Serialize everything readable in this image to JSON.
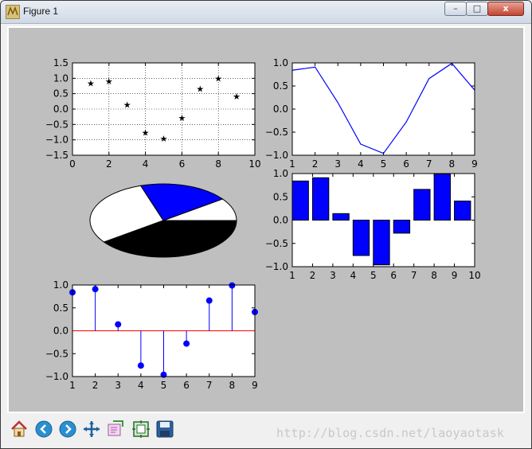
{
  "window": {
    "title": "Figure 1",
    "buttons": {
      "minimize": "–",
      "maximize": "□",
      "close": "x"
    }
  },
  "toolbar": {
    "items": [
      {
        "name": "home",
        "icon": "home-icon"
      },
      {
        "name": "back",
        "icon": "arrow-left-icon"
      },
      {
        "name": "forward",
        "icon": "arrow-right-icon"
      },
      {
        "name": "pan",
        "icon": "move-icon"
      },
      {
        "name": "zoom",
        "icon": "zoom-rect-icon"
      },
      {
        "name": "subplots",
        "icon": "subplots-icon"
      },
      {
        "name": "save",
        "icon": "floppy-icon"
      }
    ]
  },
  "watermark": "http://blog.csdn.net/laoyaotask",
  "colors": {
    "canvas": "#bfbfbf",
    "blue": "#0000ff",
    "red": "#ff0000",
    "black": "#000000",
    "white": "#ffffff"
  },
  "chart_data": [
    {
      "type": "scatter",
      "marker": "star",
      "grid": true,
      "x": [
        1,
        2,
        3,
        4,
        5,
        6,
        7,
        8,
        9
      ],
      "y": [
        0.84,
        0.91,
        0.14,
        -0.76,
        -0.96,
        -0.28,
        0.66,
        0.99,
        0.41
      ],
      "xlim": [
        0,
        10
      ],
      "ylim": [
        -1.5,
        1.5
      ],
      "xticks": [
        0,
        2,
        4,
        6,
        8,
        10
      ],
      "xtick_labels": [
        "0",
        "2",
        "4",
        "6",
        "8",
        "10"
      ],
      "yticks": [
        -1.5,
        -1.0,
        -0.5,
        0.0,
        0.5,
        1.0,
        1.5
      ],
      "ytick_labels": [
        "−1.5",
        "−1.0",
        "−0.5",
        "0.0",
        "0.5",
        "1.0",
        "1.5"
      ]
    },
    {
      "type": "line",
      "x": [
        1,
        2,
        3,
        4,
        5,
        6,
        7,
        8,
        9
      ],
      "y": [
        0.84,
        0.91,
        0.14,
        -0.76,
        -0.96,
        -0.28,
        0.66,
        0.99,
        0.41
      ],
      "xlim": [
        1,
        9
      ],
      "ylim": [
        -1.0,
        1.0
      ],
      "xticks": [
        1,
        2,
        3,
        4,
        5,
        6,
        7,
        8,
        9
      ],
      "xtick_labels": [
        "1",
        "2",
        "3",
        "4",
        "5",
        "6",
        "7",
        "8",
        "9"
      ],
      "yticks": [
        -1.0,
        -0.5,
        0.0,
        0.5,
        1.0
      ],
      "ytick_labels": [
        "−1.0",
        "−0.5",
        "0.0",
        "0.5",
        "1.0"
      ]
    },
    {
      "type": "pie",
      "values": [
        1,
        2,
        3,
        4
      ],
      "slice_colors": [
        "#ffffff",
        "#0000ff",
        "#ffffff",
        "#000000"
      ]
    },
    {
      "type": "bar",
      "categories": [
        1,
        2,
        3,
        4,
        5,
        6,
        7,
        8,
        9
      ],
      "values": [
        0.84,
        0.91,
        0.14,
        -0.76,
        -0.96,
        -0.28,
        0.66,
        0.99,
        0.41
      ],
      "xlim": [
        1,
        10
      ],
      "ylim": [
        -1.0,
        1.0
      ],
      "xticks": [
        1,
        2,
        3,
        4,
        5,
        6,
        7,
        8,
        9,
        10
      ],
      "xtick_labels": [
        "1",
        "2",
        "3",
        "4",
        "5",
        "6",
        "7",
        "8",
        "9",
        "10"
      ],
      "yticks": [
        -1.0,
        -0.5,
        0.0,
        0.5,
        1.0
      ],
      "ytick_labels": [
        "−1.0",
        "−0.5",
        "0.0",
        "0.5",
        "1.0"
      ]
    },
    {
      "type": "stem",
      "x": [
        1,
        2,
        3,
        4,
        5,
        6,
        7,
        8,
        9
      ],
      "y": [
        0.84,
        0.91,
        0.14,
        -0.76,
        -0.96,
        -0.28,
        0.66,
        0.99,
        0.41
      ],
      "xlim": [
        1,
        9
      ],
      "ylim": [
        -1.0,
        1.0
      ],
      "baseline_color": "#ff0000",
      "xticks": [
        1,
        2,
        3,
        4,
        5,
        6,
        7,
        8,
        9
      ],
      "xtick_labels": [
        "1",
        "2",
        "3",
        "4",
        "5",
        "6",
        "7",
        "8",
        "9"
      ],
      "yticks": [
        -1.0,
        -0.5,
        0.0,
        0.5,
        1.0
      ],
      "ytick_labels": [
        "−1.0",
        "−0.5",
        "0.0",
        "0.5",
        "1.0"
      ]
    }
  ]
}
